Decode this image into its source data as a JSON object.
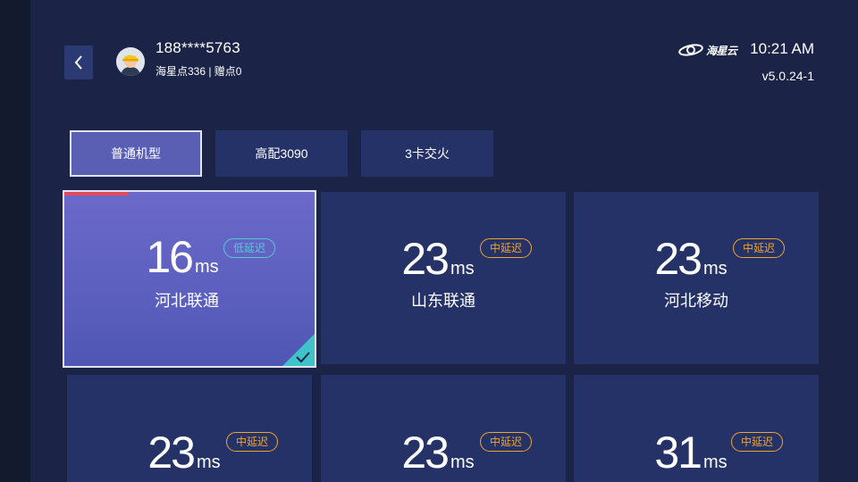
{
  "header": {
    "back_icon": "chevron-left-icon",
    "avatar_icon": "worker-avatar-icon",
    "user_phone": "188****5763",
    "user_points": "海星点336 | 赠点0",
    "brand_logo": "海星云",
    "time": "10:21 AM",
    "version": "v5.0.24-1"
  },
  "tabs": [
    {
      "label": "普通机型",
      "active": true
    },
    {
      "label": "高配3090",
      "active": false
    },
    {
      "label": "3卡交火",
      "active": false
    }
  ],
  "servers": [
    {
      "latency": "16",
      "unit": "ms",
      "badge": "低延迟",
      "region": "河北联通",
      "selected": true
    },
    {
      "latency": "23",
      "unit": "ms",
      "badge": "中延迟",
      "region": "山东联通",
      "selected": false
    },
    {
      "latency": "23",
      "unit": "ms",
      "badge": "中延迟",
      "region": "河北移动",
      "selected": false
    },
    {
      "latency": "23",
      "unit": "ms",
      "badge": "中延迟",
      "region": "",
      "selected": false
    },
    {
      "latency": "23",
      "unit": "ms",
      "badge": "中延迟",
      "region": "",
      "selected": false
    },
    {
      "latency": "31",
      "unit": "ms",
      "badge": "中延迟",
      "region": "",
      "selected": false
    }
  ],
  "colors": {
    "background": "#1b2447",
    "card": "#253267",
    "selected_card": "#6b69c9",
    "accent_red": "#e64a5a",
    "badge_medium": "#f0a32e",
    "badge_low": "#58c8d6",
    "check_teal": "#3fc2c8"
  }
}
